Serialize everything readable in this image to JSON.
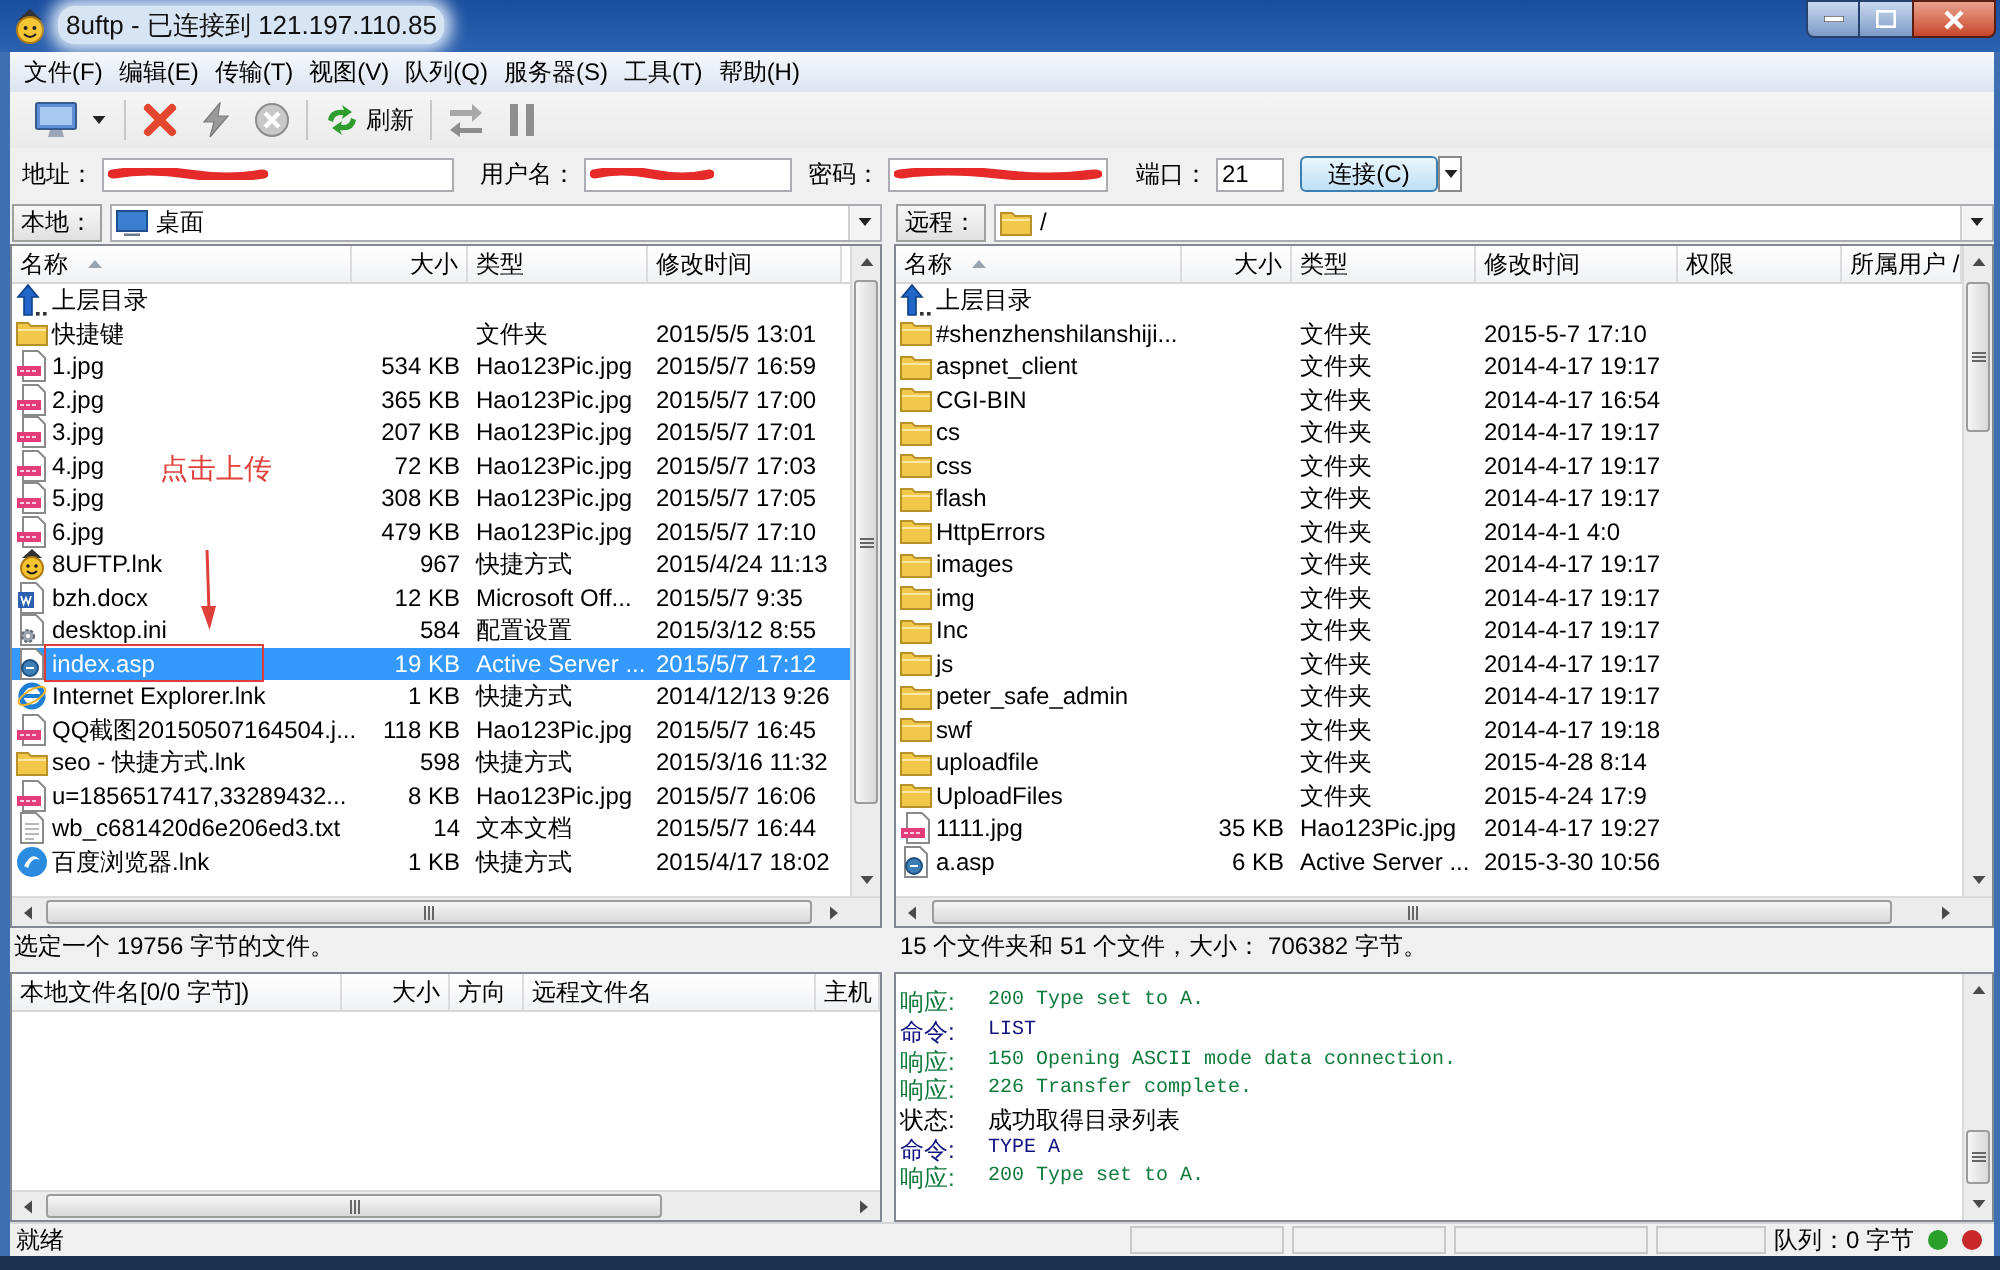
{
  "window": {
    "title": "8uftp - 已连接到 121.197.110.85"
  },
  "menu": [
    "文件(F)",
    "编辑(E)",
    "传输(T)",
    "视图(V)",
    "队列(Q)",
    "服务器(S)",
    "工具(T)",
    "帮助(H)"
  ],
  "toolbar": [
    {
      "buttons": [
        {
          "kind": "site-manager",
          "disabled": false
        }
      ]
    },
    {
      "buttons": [
        {
          "kind": "disconnect",
          "disabled": false
        },
        {
          "kind": "reconnect",
          "disabled": true
        },
        {
          "kind": "stop",
          "disabled": true
        }
      ]
    },
    {
      "buttons": [
        {
          "kind": "refresh",
          "label": "刷新",
          "disabled": false
        }
      ]
    },
    {
      "buttons": [
        {
          "kind": "transfer",
          "disabled": true
        },
        {
          "kind": "pause",
          "disabled": true
        }
      ]
    }
  ],
  "connection": {
    "fields": [
      {
        "label": "地址：",
        "redacted": true
      },
      {
        "label": "用户名：",
        "redacted": true
      },
      {
        "label": "密码：",
        "redacted": true
      },
      {
        "label": "端口：",
        "value": "21",
        "redacted": false
      }
    ],
    "connect_button": "连接(C)"
  },
  "local": {
    "label": "本地：",
    "path": "桌面",
    "columns": [
      {
        "label": "名称",
        "sorted": true
      },
      {
        "label": "大小",
        "sorted": false
      },
      {
        "label": "类型",
        "sorted": false
      },
      {
        "label": "修改时间",
        "sorted": false
      }
    ],
    "rows": [
      {
        "kind": "up",
        "name": "上层目录",
        "selected": false,
        "highlighted": false
      },
      {
        "kind": "folder",
        "name": "快捷键",
        "type": "文件夹",
        "modified": "2015/5/5 13:01",
        "selected": false,
        "highlighted": false
      },
      {
        "kind": "image",
        "name": "1.jpg",
        "size": "534 KB",
        "type": "Hao123Pic.jpg",
        "modified": "2015/5/7 16:59",
        "selected": false,
        "highlighted": false
      },
      {
        "kind": "image",
        "name": "2.jpg",
        "size": "365 KB",
        "type": "Hao123Pic.jpg",
        "modified": "2015/5/7 17:00",
        "selected": false,
        "highlighted": false
      },
      {
        "kind": "image",
        "name": "3.jpg",
        "size": "207 KB",
        "type": "Hao123Pic.jpg",
        "modified": "2015/5/7 17:01",
        "selected": false,
        "highlighted": false
      },
      {
        "kind": "image",
        "name": "4.jpg",
        "size": "72 KB",
        "type": "Hao123Pic.jpg",
        "modified": "2015/5/7 17:03",
        "selected": false,
        "highlighted": false
      },
      {
        "kind": "image",
        "name": "5.jpg",
        "size": "308 KB",
        "type": "Hao123Pic.jpg",
        "modified": "2015/5/7 17:05",
        "selected": false,
        "highlighted": false
      },
      {
        "kind": "image",
        "name": "6.jpg",
        "size": "479 KB",
        "type": "Hao123Pic.jpg",
        "modified": "2015/5/7 17:10",
        "selected": false,
        "highlighted": false
      },
      {
        "kind": "app",
        "name": "8UFTP.lnk",
        "size": "967",
        "type": "快捷方式",
        "modified": "2015/4/24 11:13",
        "selected": false,
        "highlighted": false
      },
      {
        "kind": "document",
        "name": "bzh.docx",
        "size": "12 KB",
        "type": "Microsoft Off...",
        "modified": "2015/5/7 9:35",
        "selected": false,
        "highlighted": false
      },
      {
        "kind": "settings",
        "name": "desktop.ini",
        "size": "584",
        "type": "配置设置",
        "modified": "2015/3/12 8:55",
        "selected": false,
        "highlighted": false
      },
      {
        "kind": "script",
        "name": "index.asp",
        "size": "19 KB",
        "type": "Active Server ...",
        "modified": "2015/5/7 17:12",
        "selected": true,
        "highlighted": true
      },
      {
        "kind": "web",
        "name": "Internet Explorer.lnk",
        "size": "1 KB",
        "type": "快捷方式",
        "modified": "2014/12/13 9:26",
        "selected": false,
        "highlighted": false
      },
      {
        "kind": "image",
        "name": "QQ截图20150507164504.j...",
        "size": "118 KB",
        "type": "Hao123Pic.jpg",
        "modified": "2015/5/7 16:45",
        "selected": false,
        "highlighted": false
      },
      {
        "kind": "folder",
        "name": "seo - 快捷方式.lnk",
        "size": "598",
        "type": "快捷方式",
        "modified": "2015/3/16 11:32",
        "selected": false,
        "highlighted": false
      },
      {
        "kind": "image",
        "name": "u=1856517417,33289432...",
        "size": "8 KB",
        "type": "Hao123Pic.jpg",
        "modified": "2015/5/7 16:06",
        "selected": false,
        "highlighted": false
      },
      {
        "kind": "text",
        "name": "wb_c681420d6e206ed3.txt",
        "size": "14",
        "type": "文本文档",
        "modified": "2015/5/7 16:44",
        "selected": false,
        "highlighted": false
      },
      {
        "kind": "round",
        "name": "百度浏览器.lnk",
        "size": "1 KB",
        "type": "快捷方式",
        "modified": "2015/4/17 18:02",
        "selected": false,
        "highlighted": false
      }
    ],
    "status": "选定一个 19756 字节的文件。"
  },
  "remote": {
    "label": "远程：",
    "path": "/",
    "columns": [
      {
        "label": "名称",
        "sorted": true
      },
      {
        "label": "大小",
        "sorted": false
      },
      {
        "label": "类型",
        "sorted": false
      },
      {
        "label": "修改时间",
        "sorted": false
      },
      {
        "label": "权限",
        "sorted": false
      },
      {
        "label": "所属用户 /",
        "sorted": false
      }
    ],
    "rows": [
      {
        "kind": "up",
        "name": "上层目录",
        "selected": false
      },
      {
        "kind": "folder",
        "name": "#shenzhenshilanshiji...",
        "type": "文件夹",
        "modified": "2015-5-7 17:10",
        "selected": false
      },
      {
        "kind": "folder",
        "name": "aspnet_client",
        "type": "文件夹",
        "modified": "2014-4-17 19:17",
        "selected": false
      },
      {
        "kind": "folder",
        "name": "CGI-BIN",
        "type": "文件夹",
        "modified": "2014-4-17 16:54",
        "selected": false
      },
      {
        "kind": "folder",
        "name": "cs",
        "type": "文件夹",
        "modified": "2014-4-17 19:17",
        "selected": false
      },
      {
        "kind": "folder",
        "name": "css",
        "type": "文件夹",
        "modified": "2014-4-17 19:17",
        "selected": false
      },
      {
        "kind": "folder",
        "name": "flash",
        "type": "文件夹",
        "modified": "2014-4-17 19:17",
        "selected": false
      },
      {
        "kind": "folder",
        "name": "HttpErrors",
        "type": "文件夹",
        "modified": "2014-4-1 4:0",
        "selected": false
      },
      {
        "kind": "folder",
        "name": "images",
        "type": "文件夹",
        "modified": "2014-4-17 19:17",
        "selected": false
      },
      {
        "kind": "folder",
        "name": "img",
        "type": "文件夹",
        "modified": "2014-4-17 19:17",
        "selected": false
      },
      {
        "kind": "folder",
        "name": "Inc",
        "type": "文件夹",
        "modified": "2014-4-17 19:17",
        "selected": false
      },
      {
        "kind": "folder",
        "name": "js",
        "type": "文件夹",
        "modified": "2014-4-17 19:17",
        "selected": false
      },
      {
        "kind": "folder",
        "name": "peter_safe_admin",
        "type": "文件夹",
        "modified": "2014-4-17 19:17",
        "selected": false
      },
      {
        "kind": "folder",
        "name": "swf",
        "type": "文件夹",
        "modified": "2014-4-17 19:18",
        "selected": false
      },
      {
        "kind": "folder",
        "name": "uploadfile",
        "type": "文件夹",
        "modified": "2015-4-28 8:14",
        "selected": false
      },
      {
        "kind": "folder",
        "name": "UploadFiles",
        "type": "文件夹",
        "modified": "2015-4-24 17:9",
        "selected": false
      },
      {
        "kind": "image",
        "name": "1111.jpg",
        "size": "35 KB",
        "type": "Hao123Pic.jpg",
        "modified": "2014-4-17 19:27",
        "selected": false
      },
      {
        "kind": "script",
        "name": "a.asp",
        "size": "6 KB",
        "type": "Active Server ...",
        "modified": "2015-3-30 10:56",
        "selected": false
      }
    ],
    "status": "15 个文件夹和 51 个文件，大小： 706382 字节。"
  },
  "queue": {
    "columns": [
      "本地文件名[0/0 字节])",
      "大小",
      "方向",
      "远程文件名",
      "主机"
    ]
  },
  "log": [
    {
      "kind": "response",
      "label": "响应:",
      "message": "200 Type set to A."
    },
    {
      "kind": "command",
      "label": "命令:",
      "message": "LIST"
    },
    {
      "kind": "response",
      "label": "响应:",
      "message": "150 Opening ASCII mode data connection."
    },
    {
      "kind": "response",
      "label": "响应:",
      "message": "226 Transfer complete."
    },
    {
      "kind": "status",
      "label": "状态:",
      "message": "成功取得目录列表"
    },
    {
      "kind": "command",
      "label": "命令:",
      "message": "TYPE A"
    },
    {
      "kind": "response",
      "label": "响应:",
      "message": "200 Type set to A."
    }
  ],
  "status_bar": {
    "text": "就绪",
    "queue": "队列：0 字节",
    "lights": [
      {
        "color": "#2aa02a"
      },
      {
        "color": "#c82828"
      }
    ]
  },
  "annotation": {
    "text": "点击上传"
  }
}
